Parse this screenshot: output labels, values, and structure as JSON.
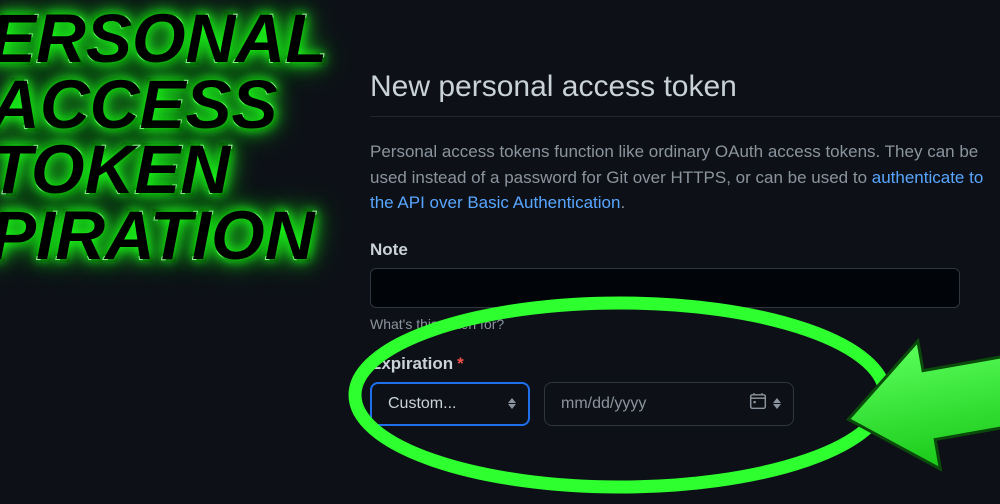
{
  "overlay": {
    "line1": "ERSONAL",
    "line2": "ACCESS",
    "line3": "TOKEN",
    "line4": "PIRATION"
  },
  "page": {
    "title": "New personal access token",
    "description_before": "Personal access tokens function like ordinary OAuth access tokens. They can be used instead of a password for Git over HTTPS, or can be used to ",
    "description_link": "authenticate to the API over Basic Authentication",
    "note_label": "Note",
    "note_value": "",
    "note_hint": "What's this token for?",
    "expiration_label": "Expiration",
    "expiration_selected": "Custom...",
    "date_placeholder": "mm/dd/yyyy"
  },
  "colors": {
    "bg": "#0d1117",
    "text": "#c9d1d9",
    "muted": "#8b949e",
    "link": "#58a6ff",
    "border": "#30363d",
    "focus": "#1f6feb",
    "highlight": "#2eff2e"
  }
}
